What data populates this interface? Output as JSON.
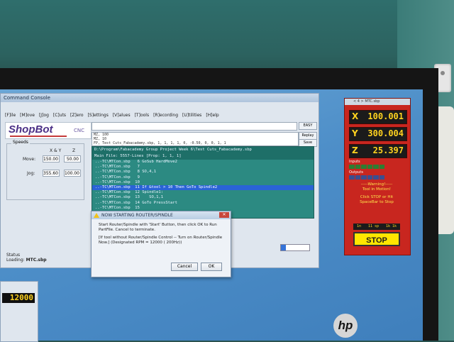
{
  "console": {
    "title": "Command Console",
    "menu": [
      "[F]ile",
      "[M]ove",
      "[J]og",
      "[C]uts",
      "[Z]ero",
      "[S]ettings",
      "[V]alues",
      "[T]ools",
      "[R]ecording",
      "[U]tilities",
      "[H]elp"
    ],
    "logo": "ShopBot",
    "logo_suffix": "CNC",
    "speeds_legend": "Speeds",
    "speeds_col_xy": "X & Y",
    "speeds_col_z": "Z",
    "move_label": "Move:",
    "move_xy": "150.00",
    "move_z": "50.00",
    "jog_label": "Jog:",
    "jog_xy": "355.60",
    "jog_z": "100.00",
    "status_label": "Status",
    "loading_label": "Loading:",
    "loading_value": "MTC.sbp",
    "easy_button": "EASY",
    "replay_button": "Replay",
    "save_button": "Save",
    "mini_list": [
      "MZ, 100",
      "MZ, 10",
      "FP, Test Cuts_Fabacademy.sbp,  1,  1,  1,  1,  0, -0.50, 0, 0,  1,  1"
    ],
    "code_header_1": "D:\\Program\\Fabacademy Group Project Week 6\\Test Cuts_Fabacademy.sbp",
    "code_header_2": "Main File:  5557-Lines [Prop: 1, 1, 1]",
    "code_lines": [
      "..-TC\\MTCon.sbp   6 GoSub HardMove2",
      "..-TC\\MTCon.sbp   7",
      "..-TC\\MTCon.sbp   8 SO,4,1",
      "..-TC\\MTCon.sbp   9",
      "..-TC\\MTCon.sbp  10",
      "..-TC\\MTCon.sbp  11 If &tool > 10 Then GoTo Spindle2",
      "..-TC\\MTCon.sbp  12 Spindle1:",
      "..-TC\\MTCon.sbp  13    SO,1,1",
      "..-TC\\MTCon.sbp  14 GoTo PressStart",
      "..-TC\\MTCon.sbp  15"
    ],
    "progress": 0.18
  },
  "dialog": {
    "title": "NOW STARTING ROUTER/SPINDLE",
    "message_1": "Start Router/Spindle with 'Start' Button, then click OK to Run PartFile. Cancel to terminate.",
    "message_2": "[If tool without Router/Spindle Control -- Turn on Router/Spindle Now.] (Designated RPM = 12000 ( 200Hz))",
    "cancel": "Cancel",
    "ok": "OK"
  },
  "rpm": {
    "value": "12000"
  },
  "dro": {
    "title": "< 4 > MTC.sbp",
    "x_label": "X",
    "x_value": "100.001",
    "y_label": "Y",
    "y_value": "300.004",
    "z_label": "Z",
    "z_value": "25.397",
    "inputs_label": "Inputs",
    "outputs_label": "Outputs",
    "warning": "-----Warning!-----",
    "warning_2": "Tool in Motion!",
    "warning_3": "Click STOP or Hit SpaceBar to Stop",
    "step_1": "1n",
    "step_2": "11 sp",
    "step_3": "1k 1k",
    "stop": "STOP"
  },
  "monitor": {
    "brand": "hp"
  }
}
